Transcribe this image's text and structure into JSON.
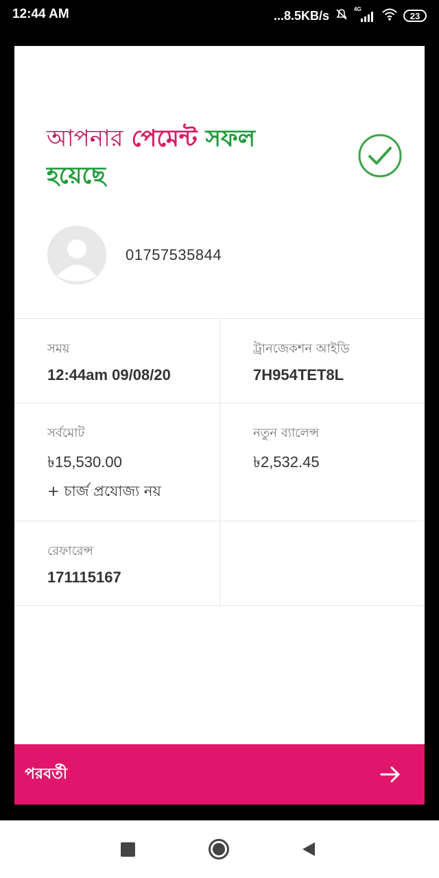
{
  "status_bar": {
    "time": "12:44 AM",
    "net_speed": "...8.5KB/s",
    "network": "4G",
    "battery": "23"
  },
  "payment": {
    "headline_word1": "আপনার",
    "headline_word2": "পেমেন্ট",
    "headline_word3": "সফল",
    "headline_word4": "হয়েছে",
    "phone": "01757535844",
    "success_color": "#3aa348"
  },
  "details": {
    "time_label": "সময়",
    "time_value": "12:44am 09/08/20",
    "txn_label": "ট্রানজেকশন আইডি",
    "txn_value": "7H954TET8L",
    "total_label": "সর্বমোট",
    "total_value": "৳15,530.00",
    "charge_note": "+ চার্জ প্রযোজ্য নয়",
    "balance_label": "নতুন ব্যালেন্স",
    "balance_value": "৳2,532.45",
    "reference_label": "রেফারেন্স",
    "reference_value": "171115167"
  },
  "footer": {
    "next_label": "পরবর্তী",
    "accent_color": "#e0156b"
  },
  "icons": [
    "check-circle-icon",
    "avatar-icon",
    "arrow-right-icon",
    "wifi-icon",
    "signal-icon",
    "mute-icon",
    "battery-icon",
    "nav-recents-icon",
    "nav-home-icon",
    "nav-back-icon"
  ]
}
